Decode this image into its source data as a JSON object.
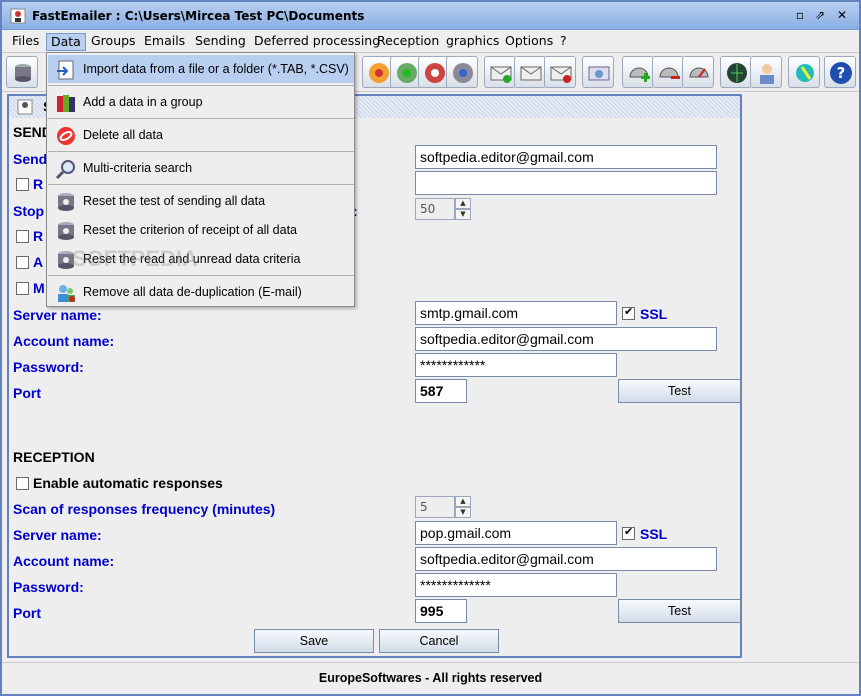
{
  "window": {
    "title": "FastEmailer : C:\\Users\\Mircea Test PC\\Documents"
  },
  "menu": [
    "Files",
    "Data",
    "Groups",
    "Emails",
    "Sending",
    "Deferred processing",
    "Reception",
    "graphics",
    "Options",
    "?"
  ],
  "dropdown": [
    {
      "label": "Import data from a file or a folder (*.TAB, *.CSV)",
      "icon": "import-icon"
    },
    {
      "label": "Add a data in a group",
      "icon": "books-icon"
    },
    {
      "label": "Delete all data",
      "icon": "delete-icon"
    },
    {
      "label": "Multi-criteria search",
      "icon": "magnifier-icon"
    },
    {
      "label": "Reset the test of sending all data",
      "icon": "database-icon"
    },
    {
      "label": "Reset the criterion of receipt of all data",
      "icon": "database-icon"
    },
    {
      "label": "Reset the read and unread data criteria",
      "icon": "database-icon"
    },
    {
      "label": "Remove all data de-duplication (E-mail)",
      "icon": "users-icon"
    }
  ],
  "panel": {
    "title": "S"
  },
  "sending": {
    "heading": "SEND",
    "sender_label": "Send",
    "sender_value": "softpedia.editor@gmail.com",
    "check1_label": "R",
    "field2_value": "",
    "stop_label": "Stop",
    "stop_suffix": ":",
    "stop_value": "50",
    "check2_label": "R",
    "check3_label": "A",
    "check4_label": "M",
    "server_label": "Server name:",
    "server_value": "smtp.gmail.com",
    "ssl_label": "SSL",
    "account_label": "Account name:",
    "account_value": "softpedia.editor@gmail.com",
    "password_label": "Password:",
    "password_value": "************",
    "port_label": "Port",
    "port_value": "587",
    "test_label": "Test"
  },
  "reception": {
    "heading": "RECEPTION",
    "auto_label": "Enable automatic responses",
    "scan_label": "Scan of responses frequency (minutes)",
    "scan_value": "5",
    "server_label": "Server name:",
    "server_value": "pop.gmail.com",
    "ssl_label": "SSL",
    "account_label": "Account name:",
    "account_value": "softpedia.editor@gmail.com",
    "password_label": "Password:",
    "password_value": "*************",
    "port_label": "Port",
    "port_value": "995",
    "test_label": "Test"
  },
  "buttons": {
    "save": "Save",
    "cancel": "Cancel"
  },
  "status": "EuropeSoftwares - All rights reserved",
  "watermark": "SOFTPEDIA"
}
